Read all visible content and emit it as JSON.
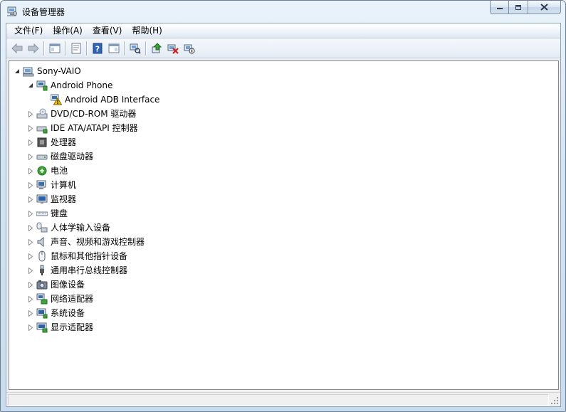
{
  "window": {
    "title": "设备管理器"
  },
  "menubar": [
    {
      "label": "文件(F)"
    },
    {
      "label": "操作(A)"
    },
    {
      "label": "查看(V)"
    },
    {
      "label": "帮助(H)"
    }
  ],
  "toolbar": [
    {
      "icon": "back-arrow-icon"
    },
    {
      "icon": "forward-arrow-icon"
    },
    {
      "icon": "show-hide-console-tree-icon"
    },
    {
      "icon": "properties-icon"
    },
    {
      "icon": "help-icon"
    },
    {
      "icon": "show-action-pane-icon"
    },
    {
      "icon": "scan-hardware-changes-icon"
    },
    {
      "icon": "update-driver-icon"
    },
    {
      "icon": "uninstall-icon"
    },
    {
      "icon": "disable-device-icon"
    }
  ],
  "tree": {
    "root": {
      "label": "Sony-VAIO",
      "icon": "computer-icon"
    },
    "nodes": [
      {
        "label": "Android Phone",
        "icon": "phone-device-icon",
        "level": 1,
        "expanded": true
      },
      {
        "label": "Android ADB Interface",
        "icon": "warning-device-icon",
        "level": 2
      },
      {
        "label": "DVD/CD-ROM 驱动器",
        "icon": "dvd-drive-icon",
        "level": 1
      },
      {
        "label": "IDE ATA/ATAPI 控制器",
        "icon": "ide-controller-icon",
        "level": 1
      },
      {
        "label": "处理器",
        "icon": "processor-icon",
        "level": 1
      },
      {
        "label": "磁盘驱动器",
        "icon": "disk-drive-icon",
        "level": 1
      },
      {
        "label": "电池",
        "icon": "battery-icon",
        "level": 1
      },
      {
        "label": "计算机",
        "icon": "computer-node-icon",
        "level": 1
      },
      {
        "label": "监视器",
        "icon": "monitor-icon",
        "level": 1
      },
      {
        "label": "键盘",
        "icon": "keyboard-icon",
        "level": 1
      },
      {
        "label": "人体学输入设备",
        "icon": "hid-icon",
        "level": 1
      },
      {
        "label": "声音、视频和游戏控制器",
        "icon": "speaker-icon",
        "level": 1
      },
      {
        "label": "鼠标和其他指针设备",
        "icon": "mouse-icon",
        "level": 1
      },
      {
        "label": "通用串行总线控制器",
        "icon": "usb-icon",
        "level": 1
      },
      {
        "label": "图像设备",
        "icon": "camera-icon",
        "level": 1
      },
      {
        "label": "网络适配器",
        "icon": "network-adapter-icon",
        "level": 1
      },
      {
        "label": "系统设备",
        "icon": "system-device-icon",
        "level": 1
      },
      {
        "label": "显示适配器",
        "icon": "display-adapter-icon",
        "level": 1
      }
    ]
  },
  "colors": {
    "accent": "#3a6ea5",
    "warning": "#f5c400",
    "error": "#d0201b"
  }
}
